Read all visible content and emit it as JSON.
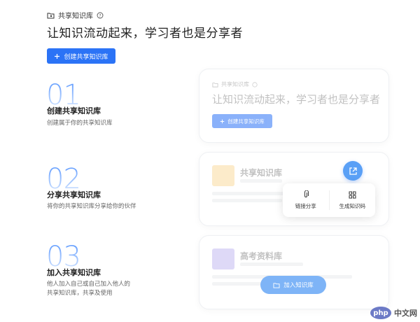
{
  "header": {
    "label": "共享知识库",
    "hero": "让知识流动起来，学习者也是分享者",
    "create_button": "创建共享知识库"
  },
  "steps": [
    {
      "num": "01",
      "title": "创建共享知识库",
      "desc": "创建属于你的共享知识库"
    },
    {
      "num": "02",
      "title": "分享共享知识库",
      "desc": "将你的共享知识库分享给你的伙伴"
    },
    {
      "num": "03",
      "title": "加入共享知识库",
      "desc_line1": "他人加入自己或自己加入他人的",
      "desc_line2": "共享知识库，共享及使用"
    }
  ],
  "card1": {
    "label": "共享知识库",
    "hero": "让知识流动起来，学习者也是分享者",
    "button": "创建共享知识库"
  },
  "card2": {
    "kb_title": "共享知识库",
    "share_options": {
      "link": "链接分享",
      "code": "生成知识码"
    }
  },
  "card3": {
    "kb_title": "高考资料库",
    "join_button": "加入知识库"
  },
  "watermark": {
    "logo": "php",
    "text": "中文网"
  },
  "colors": {
    "primary": "#2b73f6",
    "fab": "#5aa0f6",
    "join": "#7eb4f7"
  }
}
